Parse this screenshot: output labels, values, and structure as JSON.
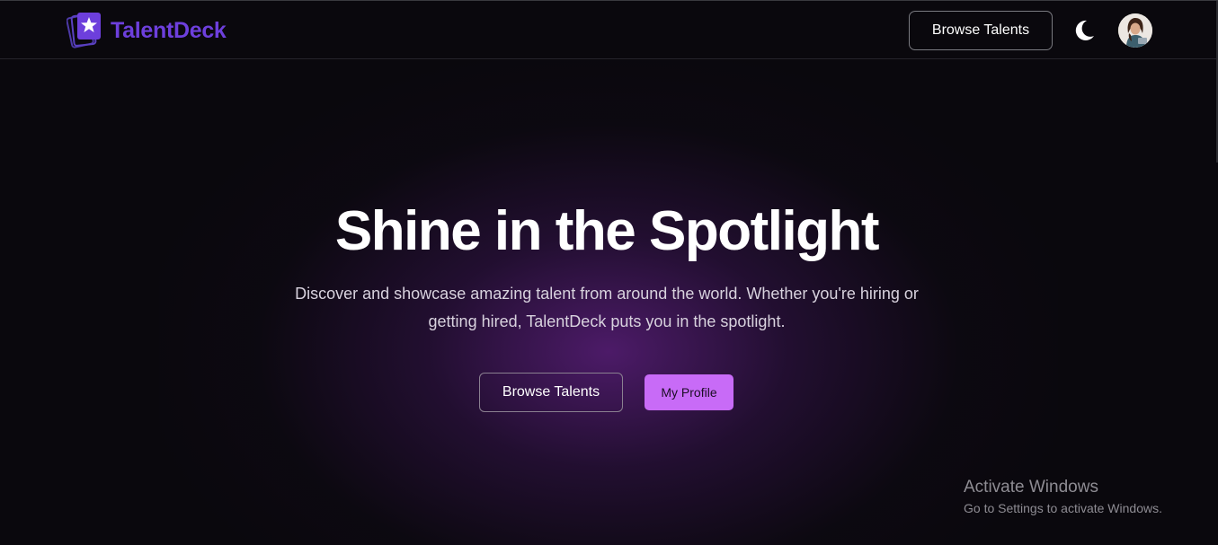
{
  "navbar": {
    "brand": "TalentDeck",
    "browse_label": "Browse Talents",
    "theme_icon": "moon-icon",
    "avatar_icon": "user-avatar"
  },
  "hero": {
    "title": "Shine in the Spotlight",
    "subtitle": "Discover and showcase amazing talent from around the world. Whether you're hiring or getting hired, TalentDeck puts you in the spotlight.",
    "browse_label": "Browse Talents",
    "profile_label": "My Profile"
  },
  "watermark": {
    "title": "Activate Windows",
    "subtitle": "Go to Settings to activate Windows."
  },
  "colors": {
    "background": "#0a080d",
    "brand": "#6d3fdc",
    "accent": "#c86bf7",
    "glow": "#581e78"
  }
}
